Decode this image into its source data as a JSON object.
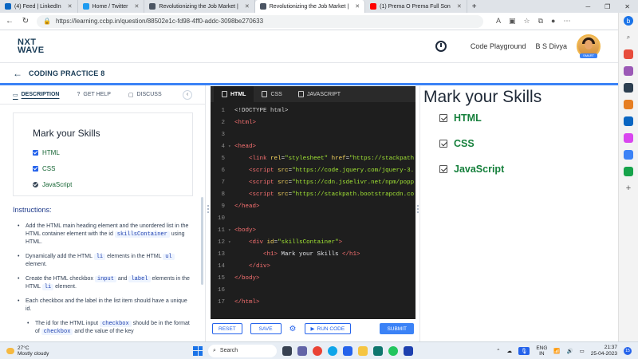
{
  "browser": {
    "tabs": [
      {
        "label": "(4) Feed | LinkedIn",
        "color": "#0a66c2"
      },
      {
        "label": "Home / Twitter",
        "color": "#1d9bf0"
      },
      {
        "label": "Revolutionizing the Job Market |",
        "color": "#4b5563"
      },
      {
        "label": "Revolutionizing the Job Market |",
        "color": "#4b5563"
      },
      {
        "label": "(1) Prema O Prema Full Son",
        "color": "#ff0000"
      }
    ],
    "url": "https://learning.ccbp.in/question/88502e1c-fd98-4ff0-addc-3098be270633"
  },
  "header": {
    "logo_line1": "NXT",
    "logo_line2": "WAVE",
    "code_playground": "Code Playground",
    "user_name": "B S Divya",
    "avatar_badge": "SMART"
  },
  "titlebar": {
    "title": "CODING PRACTICE 8"
  },
  "left": {
    "tabs": [
      "DESCRIPTION",
      "GET HELP",
      "DISCUSS"
    ],
    "preview_title": "Mark your Skills",
    "preview_items": [
      "HTML",
      "CSS",
      "JavaScript"
    ],
    "instructions_title": "Instructions:",
    "instructions": [
      {
        "parts": [
          "Add the HTML main heading element and the unordered list in the HTML container element with the id ",
          "skillsContainer",
          " using HTML."
        ]
      },
      {
        "parts": [
          "Dynamically add the HTML ",
          "li",
          " elements in the HTML ",
          "ul",
          " element."
        ]
      },
      {
        "parts": [
          "Create the HTML checkbox ",
          "input",
          " and ",
          "label",
          " elements in the HTML ",
          "li",
          " element."
        ]
      },
      {
        "parts": [
          "Each checkbox and the label in the list item should have a unique id."
        ]
      },
      {
        "parts": [
          "The id for the HTML input ",
          "checkbox",
          " should be in the format of ",
          "checkbox",
          " and the value of the key"
        ]
      }
    ]
  },
  "editor": {
    "tabs": [
      "HTML",
      "CSS",
      "JAVASCRIPT"
    ],
    "lines": [
      {
        "n": "1",
        "fold": "",
        "html": "&lt;!DOCTYPE html&gt;"
      },
      {
        "n": "2",
        "fold": "",
        "html": "<span class='tok-tag'>&lt;html&gt;</span>"
      },
      {
        "n": "3",
        "fold": "",
        "html": ""
      },
      {
        "n": "4",
        "fold": "▾",
        "html": "<span class='tok-tag'>&lt;head&gt;</span>"
      },
      {
        "n": "5",
        "fold": "",
        "html": "    <span class='tok-tag'>&lt;link</span> <span class='tok-attr'>rel</span>=<span class='tok-str'>\"stylesheet\"</span> <span class='tok-attr'>href</span>=<span class='tok-str'>\"https://stackpath</span>"
      },
      {
        "n": "6",
        "fold": "",
        "html": "    <span class='tok-tag'>&lt;script</span> <span class='tok-attr'>src</span>=<span class='tok-str'>\"https://code.jquery.com/jquery-3.</span>"
      },
      {
        "n": "7",
        "fold": "",
        "html": "    <span class='tok-tag'>&lt;script</span> <span class='tok-attr'>src</span>=<span class='tok-str'>\"https://cdn.jsdelivr.net/npm/popp</span>"
      },
      {
        "n": "8",
        "fold": "",
        "html": "    <span class='tok-tag'>&lt;script</span> <span class='tok-attr'>src</span>=<span class='tok-str'>\"https://stackpath.bootstrapcdn.co</span>"
      },
      {
        "n": "9",
        "fold": "",
        "html": "<span class='tok-tag'>&lt;/head&gt;</span>"
      },
      {
        "n": "10",
        "fold": "",
        "html": ""
      },
      {
        "n": "11",
        "fold": "▾",
        "html": "<span class='tok-tag'>&lt;body&gt;</span>"
      },
      {
        "n": "12",
        "fold": "▾",
        "html": "    <span class='tok-tag'>&lt;div</span> <span class='tok-attr'>id</span>=<span class='tok-str'>\"skillsContainer\"</span><span class='tok-tag'>&gt;</span>"
      },
      {
        "n": "13",
        "fold": "",
        "html": "        <span class='tok-tag'>&lt;h1&gt;</span><span class='tok-txt'> Mark your Skills </span><span class='tok-tag'>&lt;/h1&gt;</span>"
      },
      {
        "n": "14",
        "fold": "",
        "html": "    <span class='tok-tag'>&lt;/div&gt;</span>"
      },
      {
        "n": "15",
        "fold": "",
        "html": "<span class='tok-tag'>&lt;/body&gt;</span>"
      },
      {
        "n": "16",
        "fold": "",
        "html": ""
      },
      {
        "n": "17",
        "fold": "",
        "html": "<span class='tok-tag'>&lt;/html&gt;</span>"
      }
    ],
    "footer": {
      "reset": "RESET",
      "save": "SAVE",
      "run": "RUN CODE",
      "submit": "SUBMIT"
    }
  },
  "output": {
    "heading": "Mark your Skills",
    "items": [
      "HTML",
      "CSS",
      "JavaScript"
    ]
  },
  "taskbar": {
    "temp": "27°C",
    "weather": "Mostly cloudy",
    "search": "Search",
    "lang1": "ENG",
    "lang2": "IN",
    "time": "21:37",
    "date": "25-04-2023"
  }
}
